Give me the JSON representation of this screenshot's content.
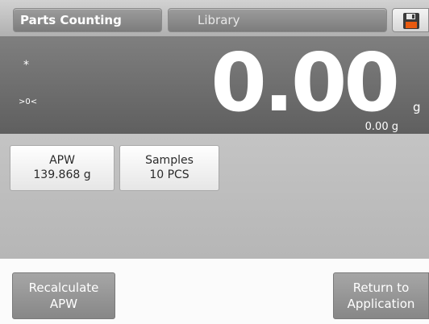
{
  "header": {
    "mode_tab": "Parts Counting",
    "library_tab": "Library",
    "save_icon": "floppy-disk-icon"
  },
  "display": {
    "stable_indicator": "*",
    "zero_indicator": ">0<",
    "reading": "0.00",
    "unit": "g",
    "secondary_reading": "0.00 g"
  },
  "info": {
    "apw": {
      "label": "APW",
      "value": "139.868 g"
    },
    "samples": {
      "label": "Samples",
      "value": "10 PCS"
    }
  },
  "footer": {
    "recalculate": {
      "line1": "Recalculate",
      "line2": "APW"
    },
    "return": {
      "line1": "Return to",
      "line2": "Application"
    }
  },
  "colors": {
    "display_bg": "#6f6f6f",
    "info_bg": "#bdbdbd",
    "footer_bg": "#fbfbfb",
    "button_bg": "#979797"
  }
}
